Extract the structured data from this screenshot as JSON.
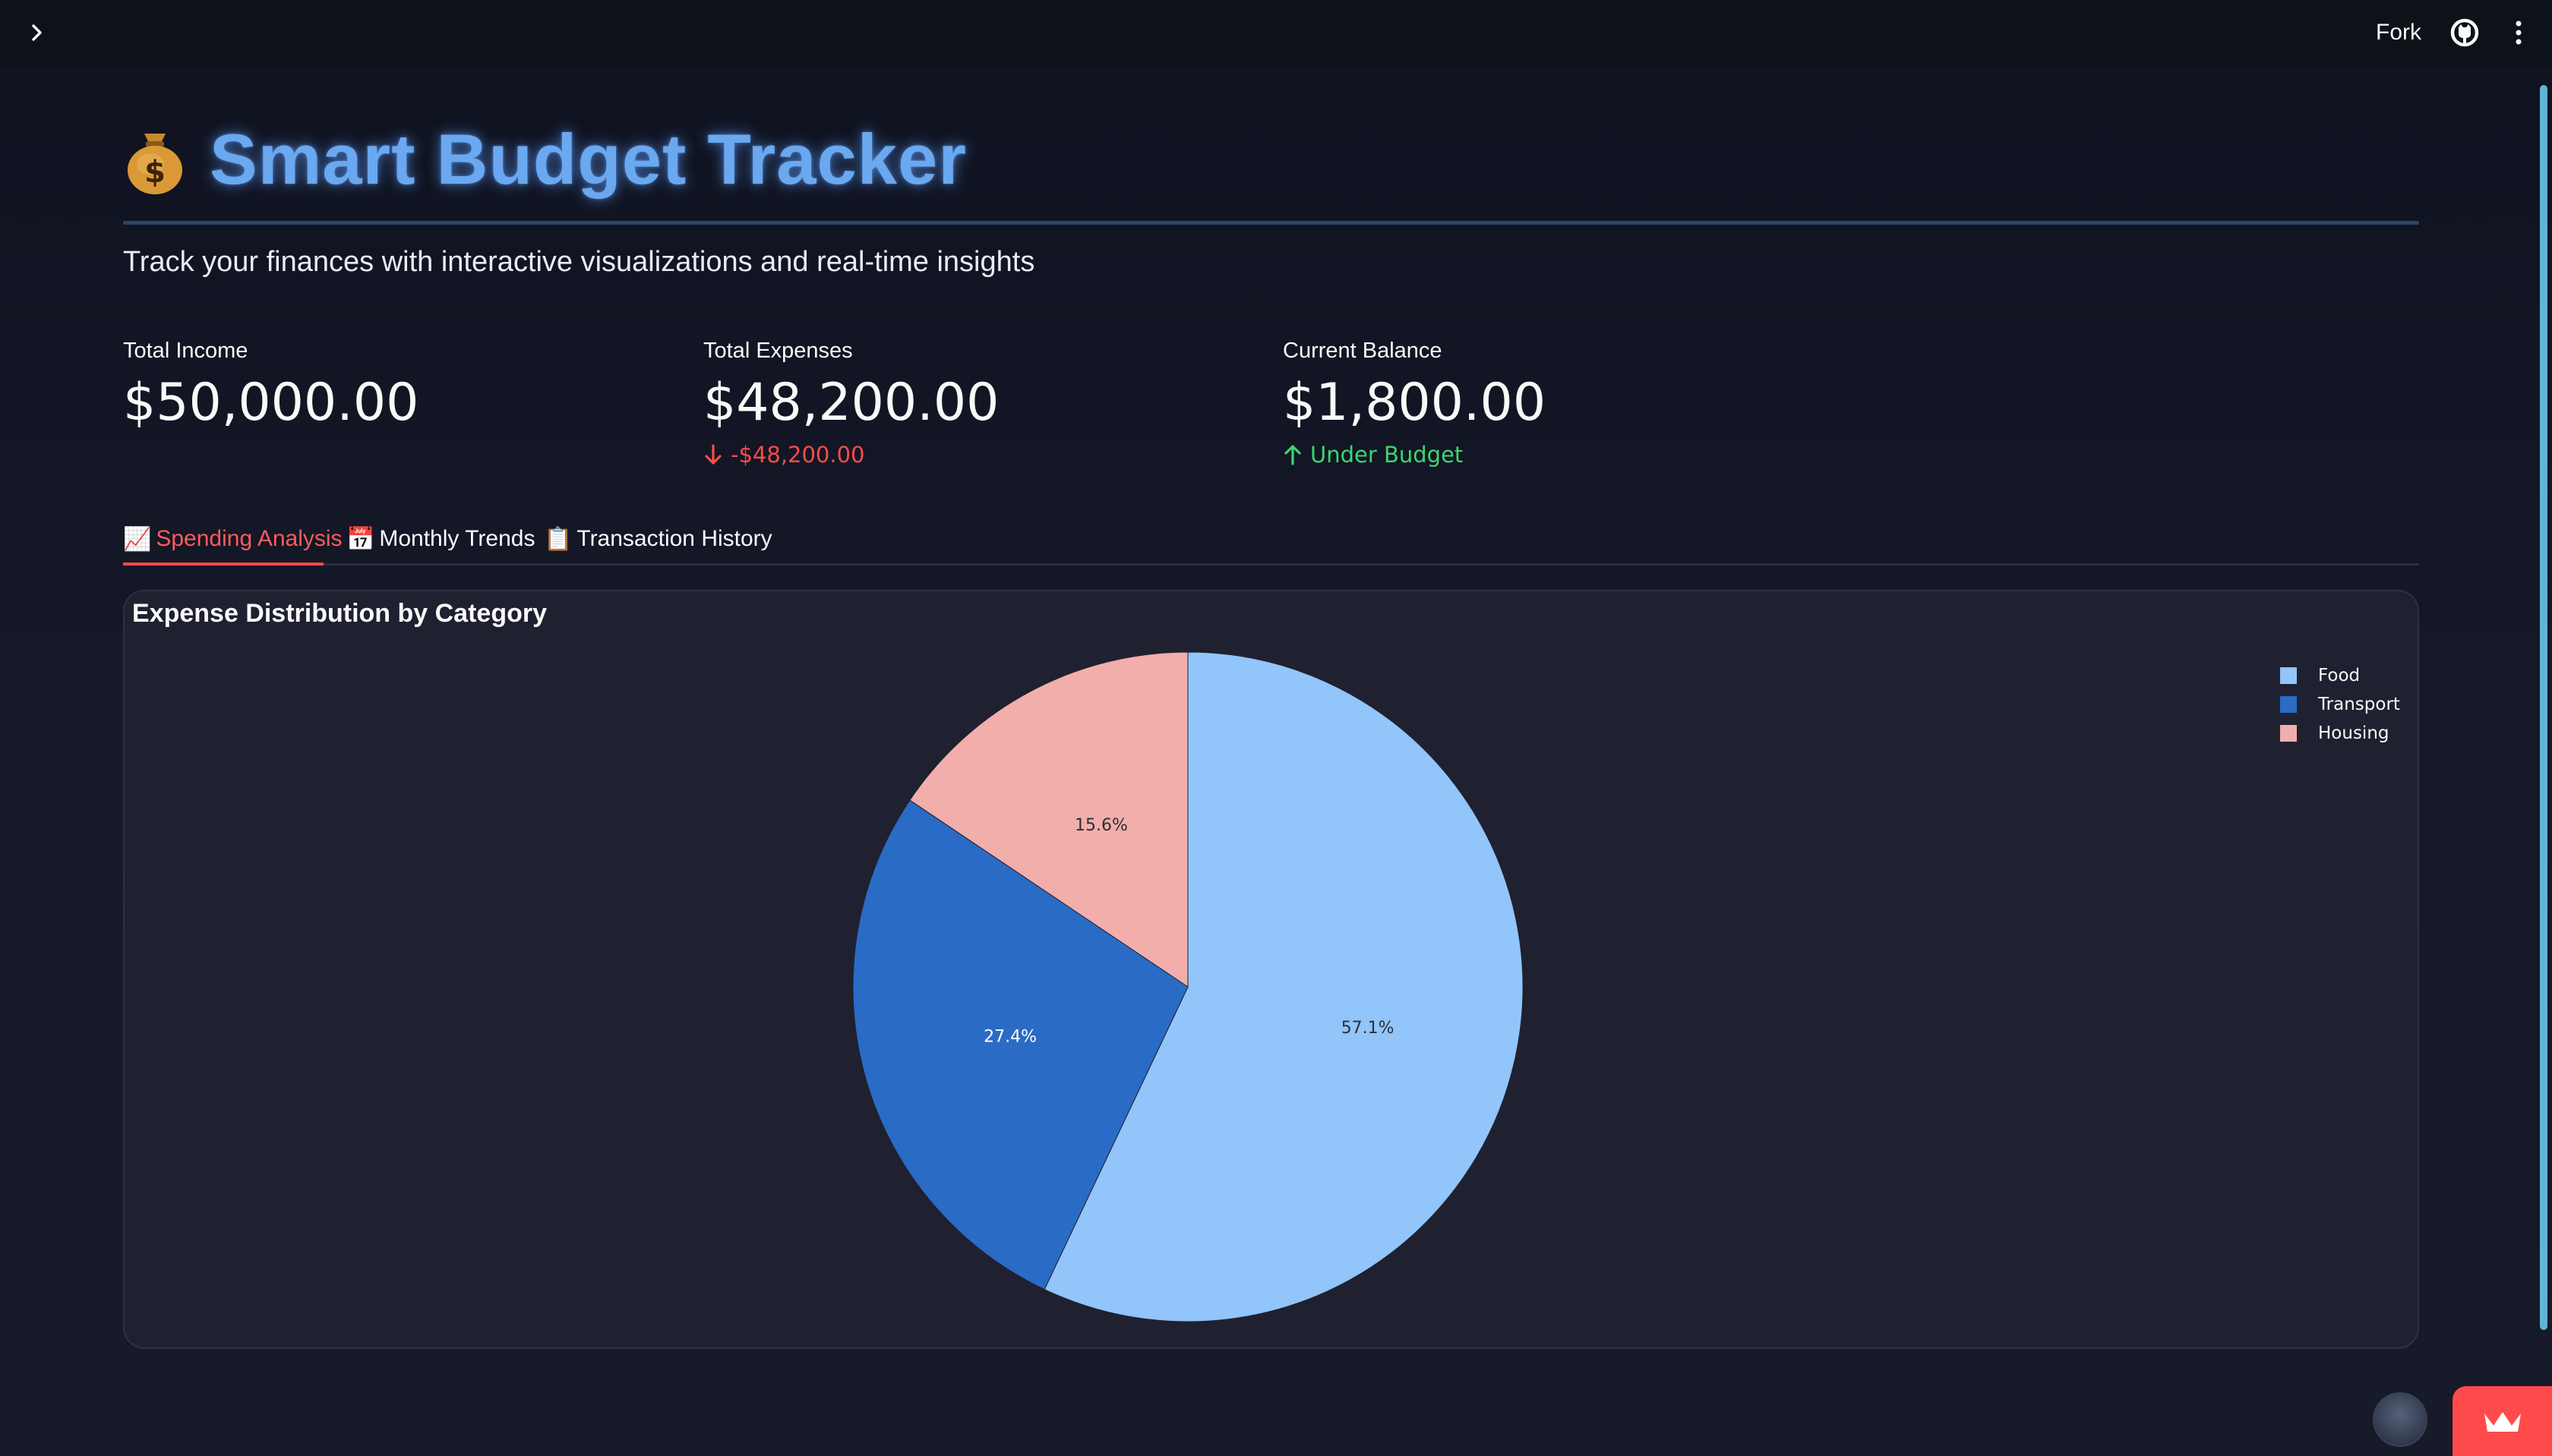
{
  "header": {
    "fork_label": "Fork"
  },
  "page": {
    "icon": "money-bag",
    "title": "Smart Budget Tracker",
    "subtitle": "Track your finances with interactive visualizations and real-time insights"
  },
  "metrics": [
    {
      "label": "Total Income",
      "value": "$50,000.00",
      "delta": ""
    },
    {
      "label": "Total Expenses",
      "value": "$48,200.00",
      "delta": "-$48,200.00",
      "delta_direction": "down"
    },
    {
      "label": "Current Balance",
      "value": "$1,800.00",
      "delta": "Under Budget",
      "delta_direction": "up"
    }
  ],
  "tabs": [
    {
      "icon": "📈",
      "label": "Spending Analysis",
      "active": true
    },
    {
      "icon": "📅",
      "label": "Monthly Trends",
      "active": false
    },
    {
      "icon": "📋",
      "label": "Transaction History",
      "active": false
    }
  ],
  "colors": {
    "accent": "#ff4b4b",
    "positive": "#3dd56d",
    "title": "#6aa8f0",
    "food": "#92c5f9",
    "transport": "#2a6bc6",
    "housing": "#f2aeab"
  },
  "chart_data": {
    "type": "pie",
    "title": "Expense Distribution by Category",
    "categories": [
      "Food",
      "Transport",
      "Housing"
    ],
    "values": [
      57.1,
      27.4,
      15.6
    ],
    "labels": [
      "57.1%",
      "27.4%",
      "15.6%"
    ],
    "legend_position": "top-right"
  }
}
